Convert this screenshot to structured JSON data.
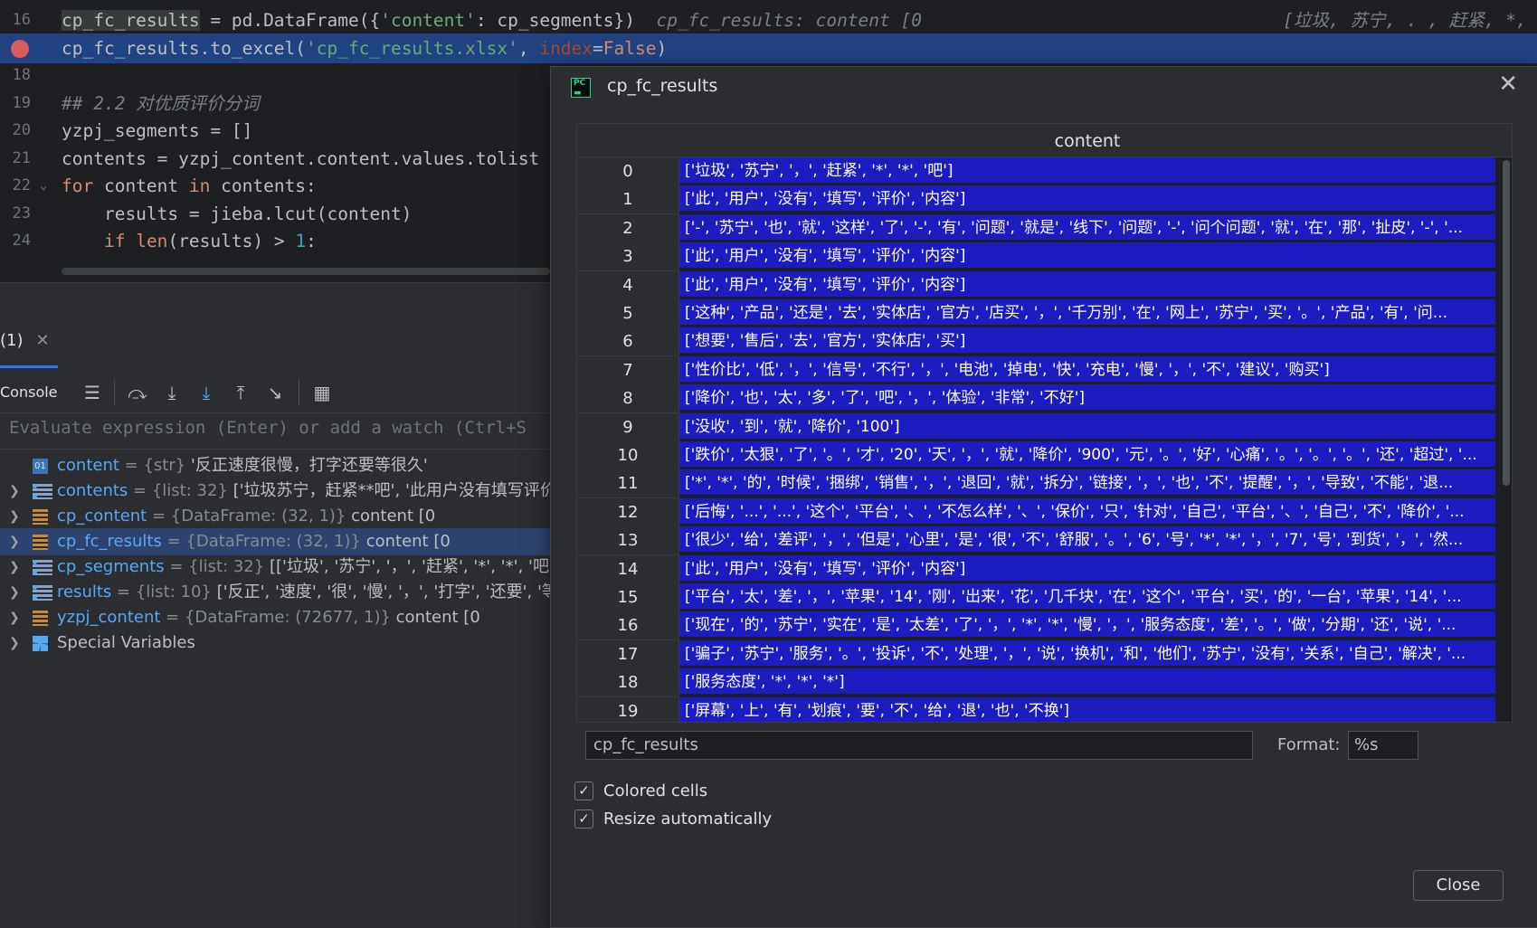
{
  "editor": {
    "lines": [
      {
        "num": "16",
        "parts": [
          {
            "t": "cp_fc_results",
            "c": "hl-var"
          },
          {
            "t": " = pd.DataFrame({",
            "c": ""
          },
          {
            "t": "'content'",
            "c": "str"
          },
          {
            "t": ": cp_segments})  ",
            "c": ""
          },
          {
            "t": "cp_fc_results: content [0",
            "c": "inlay"
          },
          {
            "t": "                                  [垃圾, 苏宁, . , 赶紧, *, *, 吧]",
            "c": "inlay"
          }
        ]
      },
      {
        "num": "",
        "breakpoint": true,
        "highlight": true,
        "parts": [
          {
            "t": "cp_fc_results.to_excel(",
            "c": ""
          },
          {
            "t": "'cp_fc_results.xlsx'",
            "c": "str"
          },
          {
            "t": ", ",
            "c": ""
          },
          {
            "t": "index",
            "c": "param"
          },
          {
            "t": "=",
            "c": ""
          },
          {
            "t": "False",
            "c": "kw"
          },
          {
            "t": ")",
            "c": ""
          }
        ]
      },
      {
        "num": "18",
        "parts": []
      },
      {
        "num": "19",
        "parts": [
          {
            "t": "## 2.2 对优质评价分词",
            "c": "cmt"
          }
        ]
      },
      {
        "num": "20",
        "parts": [
          {
            "t": "yzpj_segments = []",
            "c": ""
          }
        ]
      },
      {
        "num": "21",
        "parts": [
          {
            "t": "contents = yzpj_content.content.values.tolist",
            "c": ""
          }
        ]
      },
      {
        "num": "22",
        "fold": true,
        "parts": [
          {
            "t": "for",
            "c": "kw"
          },
          {
            "t": " content ",
            "c": ""
          },
          {
            "t": "in",
            "c": "kw"
          },
          {
            "t": " contents:",
            "c": ""
          }
        ]
      },
      {
        "num": "23",
        "parts": [
          {
            "t": "    results = jieba.lcut(content)",
            "c": ""
          }
        ]
      },
      {
        "num": "24",
        "parts": [
          {
            "t": "    ",
            "c": ""
          },
          {
            "t": "if",
            "c": "kw"
          },
          {
            "t": " ",
            "c": ""
          },
          {
            "t": "len",
            "c": "kw"
          },
          {
            "t": "(results) > ",
            "c": ""
          },
          {
            "t": "1",
            "c": "num"
          },
          {
            "t": ":",
            "c": ""
          }
        ]
      }
    ]
  },
  "debug": {
    "tab_label": "(1)",
    "console_label": "Console",
    "eval_placeholder": "Evaluate expression (Enter) or add a watch (Ctrl+S",
    "variables": [
      {
        "name": "content",
        "type": " = {str} ",
        "value": "'反正速度很慢，打字还要等很久'",
        "icon": "str",
        "expand": false
      },
      {
        "name": "contents",
        "type": " = {list: 32} ",
        "value": "['垃圾苏宁，赶紧**吧', '此用户没有填写评价",
        "icon": "list",
        "expand": true
      },
      {
        "name": "cp_content",
        "type": " = {DataFrame: (32, 1)} ",
        "value": "content [0",
        "icon": "df",
        "expand": true
      },
      {
        "name": "cp_fc_results",
        "type": " = {DataFrame: (32, 1)} ",
        "value": "content [0",
        "icon": "df",
        "expand": true,
        "selected": true
      },
      {
        "name": "cp_segments",
        "type": " = {list: 32} ",
        "value": "[['垃圾', '苏宁', '，', '赶紧', '*', '*', '吧'], [",
        "icon": "list",
        "expand": true
      },
      {
        "name": "results",
        "type": " = {list: 10} ",
        "value": "['反正', '速度', '很', '慢', '，', '打字', '还要', '等', '",
        "icon": "list",
        "expand": true
      },
      {
        "name": "yzpj_content",
        "type": " = {DataFrame: (72677, 1)} ",
        "value": "content [0",
        "icon": "df",
        "expand": true
      },
      {
        "name": "",
        "type": "",
        "value": "Special Variables",
        "icon": "special",
        "expand": true
      }
    ]
  },
  "dialog": {
    "title": "cp_fc_results",
    "column_header": "content",
    "rows": [
      {
        "idx": "0",
        "val": "['垃圾', '苏宁', '，', '赶紧', '*', '*', '吧']"
      },
      {
        "idx": "1",
        "val": "['此', '用户', '没有', '填写', '评价', '内容']"
      },
      {
        "idx": "2",
        "val": "['-', '苏宁', '也', '就', '这样', '了', '-', '有', '问题', '就是', '线下', '问题', '-', '问个问题', '就', '在', '那', '扯皮', '-', '..."
      },
      {
        "idx": "3",
        "val": "['此', '用户', '没有', '填写', '评价', '内容']"
      },
      {
        "idx": "4",
        "val": "['此', '用户', '没有', '填写', '评价', '内容']"
      },
      {
        "idx": "5",
        "val": "['这种', '产品', '还是', '去', '实体店', '官方', '店买', '，', '千万别', '在', '网上', '苏宁', '买', '。', '产品', '有', '问..."
      },
      {
        "idx": "6",
        "val": "['想要', '售后', '去', '官方', '实体店', '买']"
      },
      {
        "idx": "7",
        "val": "['性价比', '低', '，', '信号', '不行', '，', '电池', '掉电', '快', '充电', '慢', '，', '不', '建议', '购买']"
      },
      {
        "idx": "8",
        "val": "['降价', '也', '太', '多', '了', '吧', '，', '体验', '非常', '不好']"
      },
      {
        "idx": "9",
        "val": "['没收', '到', '就', '降价', '100']"
      },
      {
        "idx": "10",
        "val": "['跌价', '太狠', '了', '。', '才', '20', '天', '，', '就', '降价', '900', '元', '。', '好', '心痛', '。', '。', '。', '还', '超过', '..."
      },
      {
        "idx": "11",
        "val": "['*', '*', '的', '时候', '捆绑', '销售', '，', '退回', '就', '拆分', '链接', '，', '也', '不', '提醒', '，', '导致', '不能', '退..."
      },
      {
        "idx": "12",
        "val": "['后悔', '...', '...', '这个', '平台', '、', '不怎么样', '、', '保价', '只', '针对', '自己', '平台', '、', '自己', '不', '降价', '..."
      },
      {
        "idx": "13",
        "val": "['很少', '给', '差评', '，', '但是', '心里', '是', '很', '不', '舒服', '。', '6', '号', '*', '*', '，', '7', '号', '到货', '，', '然..."
      },
      {
        "idx": "14",
        "val": "['此', '用户', '没有', '填写', '评价', '内容']"
      },
      {
        "idx": "15",
        "val": "['平台', '太', '差', '，', '苹果', '14', '刚', '出来', '花', '几千块', '在', '这个', '平台', '买', '的', '一台', '苹果', '14', '..."
      },
      {
        "idx": "16",
        "val": "['现在', '的', '苏宁', '实在', '是', '太差', '了', '，', '*', '*', '慢', '，', '服务态度', '差', '。', '做', '分期', '还', '说', '..."
      },
      {
        "idx": "17",
        "val": "['骗子', '苏宁', '服务', '。', '投诉', '不', '处理', '，', '说', '换机', '和', '他们', '苏宁', '没有', '关系', '自己', '解决', '..."
      },
      {
        "idx": "18",
        "val": "['服务态度', '*', '*', '*']"
      },
      {
        "idx": "19",
        "val": "['屏幕', '上', '有', '划痕', '要', '不', '给', '退', '也', '不换']"
      }
    ],
    "name_field": "cp_fc_results",
    "format_label": "Format:",
    "format_value": "%s",
    "colored_cells": "Colored cells",
    "resize_auto": "Resize automatically",
    "close_label": "Close"
  }
}
